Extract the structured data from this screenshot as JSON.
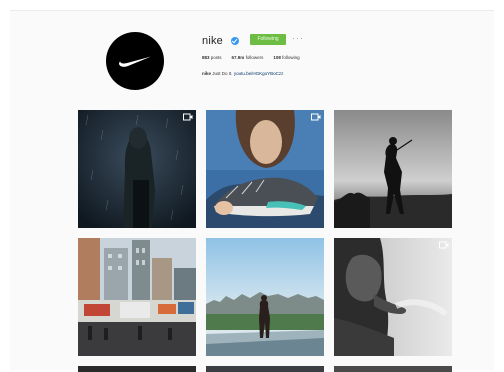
{
  "profile": {
    "username": "nike",
    "follow_label": "Following",
    "more_label": "···",
    "stats": {
      "posts_count": "883",
      "posts_label": "posts",
      "followers_count": "67.9m",
      "followers_label": "followers",
      "following_count": "108",
      "following_label": "following"
    },
    "bio_name": "nike",
    "bio_text": "Just Do It.",
    "bio_link": "youtu.be/HGKgoYBoCzz"
  },
  "colors": {
    "follow_button": "#6dbd45",
    "verified_badge": "#3897f0",
    "avatar": "#000000"
  },
  "posts": [
    {
      "subject": "runner-in-rain",
      "icon": "video-camera-icon"
    },
    {
      "subject": "woman-holding-shoe",
      "icon": "video-camera-icon"
    },
    {
      "subject": "golfer-silhouette",
      "icon": ""
    },
    {
      "subject": "city-street",
      "icon": ""
    },
    {
      "subject": "man-on-rooftop",
      "icon": ""
    },
    {
      "subject": "athlete-portrait",
      "icon": "video-camera-icon"
    }
  ]
}
